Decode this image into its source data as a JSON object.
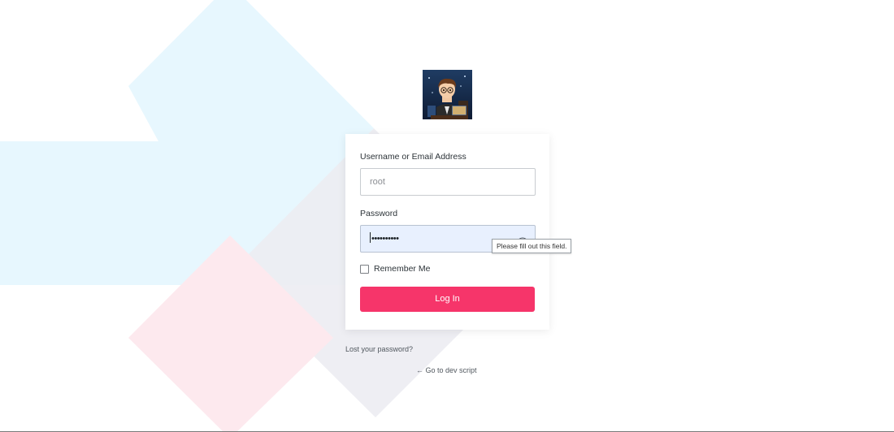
{
  "colors": {
    "accent": "#f6356a",
    "shape_blue": "#e7f7fe",
    "shape_pink": "#fde9ee",
    "autofill": "#e8f0fe"
  },
  "logo": {
    "icon": "avatar-boy-at-laptop"
  },
  "form": {
    "username_label": "Username or Email Address",
    "username_value": "root",
    "password_label": "Password",
    "password_value": "••••••••••",
    "password_toggle_icon": "eye-icon",
    "validation_tooltip": "Please fill out this field.",
    "remember_label": "Remember Me",
    "submit_label": "Log In"
  },
  "links": {
    "lost_password": "Lost your password?",
    "back_link": "← Go to dev script"
  }
}
